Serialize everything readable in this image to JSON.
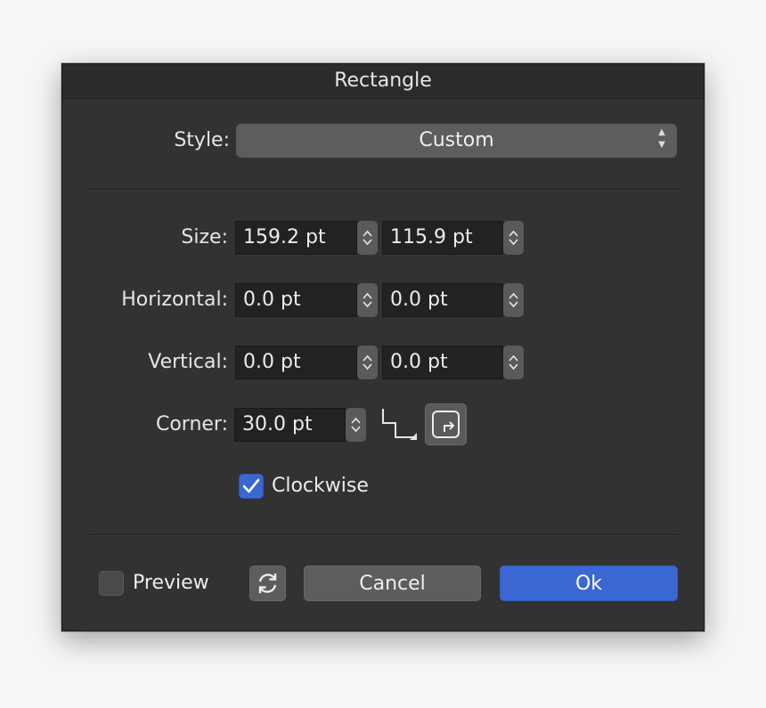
{
  "dialog": {
    "title": "Rectangle"
  },
  "style": {
    "label": "Style:",
    "value": "Custom"
  },
  "size": {
    "label": "Size:",
    "width": "159.2 pt",
    "height": "115.9 pt"
  },
  "horizontal": {
    "label": "Horizontal:",
    "value1": "0.0 pt",
    "value2": "0.0 pt"
  },
  "vertical": {
    "label": "Vertical:",
    "value1": "0.0 pt",
    "value2": "0.0 pt"
  },
  "corner": {
    "label": "Corner:",
    "value": "30.0 pt"
  },
  "clockwise": {
    "label": "Clockwise",
    "checked": true
  },
  "footer": {
    "preview_label": "Preview",
    "preview_checked": false,
    "cancel_label": "Cancel",
    "ok_label": "Ok"
  },
  "icons": {
    "popup": "up-down-arrows-icon",
    "stepper": "chevron-up-down-icon",
    "corner_shape": "step-corner-icon",
    "corner_toggle": "rounded-corner-icon",
    "checkmark": "checkmark-icon",
    "reset": "refresh-icon"
  },
  "colors": {
    "dialog_bg": "#323232",
    "accent": "#3b67d3",
    "field_bg": "#222222",
    "control_gray": "#5d5d5d"
  }
}
